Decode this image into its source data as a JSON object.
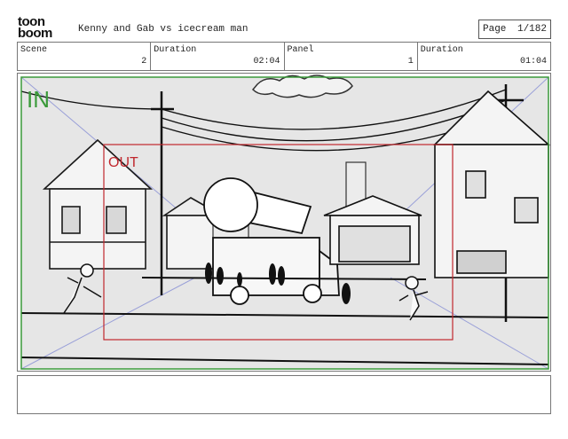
{
  "logo": {
    "line1": "toon",
    "line2": "boom"
  },
  "header": {
    "title": "Kenny and Gab vs icecream man"
  },
  "page": {
    "label": "Page",
    "number": "1/182"
  },
  "info": {
    "scene_label": "Scene",
    "scene_value": "2",
    "duration_label": "Duration",
    "duration_value": "02:04",
    "panel_label": "Panel",
    "panel_value": "1",
    "panel_duration_label": "Duration",
    "panel_duration_value": "01:04"
  },
  "frame_labels": {
    "in": "IN",
    "out": "OUT"
  },
  "colors": {
    "in_frame": "#3a9a3a",
    "out_frame": "#c0272d",
    "perspective": "#9aa0d8"
  },
  "notes": {
    "text": ""
  }
}
